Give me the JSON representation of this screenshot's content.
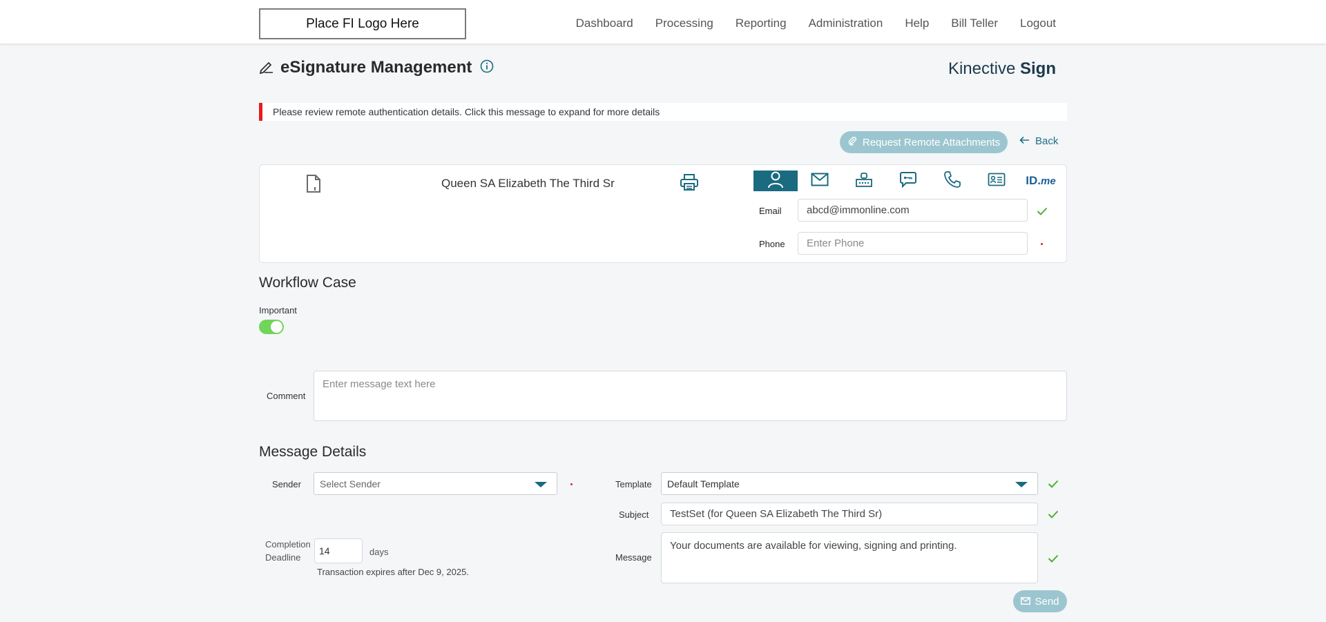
{
  "header": {
    "logo_text": "Place FI Logo Here",
    "nav": [
      "Dashboard",
      "Processing",
      "Reporting",
      "Administration",
      "Help",
      "Bill Teller",
      "Logout"
    ]
  },
  "page": {
    "title": "eSignature Management",
    "brand_light": "Kinective",
    "brand_bold": "Sign"
  },
  "alert": {
    "text": "Please review remote authentication details. Click this message to expand for more details",
    "color": "#e0201f"
  },
  "actions": {
    "request_attachments": "Request Remote Attachments",
    "back": "Back"
  },
  "signer": {
    "name": "Queen SA Elizabeth The Third Sr",
    "auth_tabs": [
      "person-icon",
      "mail-icon",
      "keypad-icon",
      "chat-icon",
      "phone-icon",
      "id-card-icon",
      "idme-icon"
    ],
    "idme_text": "ID.",
    "idme_suffix": "me",
    "email_label": "Email",
    "email_value": "abcd@immonline.com",
    "phone_label": "Phone",
    "phone_placeholder": "Enter Phone"
  },
  "workflow": {
    "heading": "Workflow Case",
    "important_label": "Important",
    "important_on": true,
    "comment_label": "Comment",
    "comment_placeholder": "Enter message text here"
  },
  "message_details": {
    "heading": "Message Details",
    "sender_label": "Sender",
    "sender_placeholder": "Select Sender",
    "template_label": "Template",
    "template_value": "Default Template",
    "subject_label": "Subject",
    "subject_value": "TestSet (for Queen SA Elizabeth The Third Sr)",
    "message_label": "Message",
    "message_value": "Your documents are available for viewing, signing and printing.",
    "deadline_label_1": "Completion",
    "deadline_label_2": "Deadline",
    "deadline_value": "14",
    "deadline_unit": "days",
    "expiry_note": "Transaction expires after Dec 9, 2025.",
    "send_label": "Send"
  },
  "colors": {
    "accent": "#1a6a80",
    "button_disabled": "#9cc6cf",
    "success": "#4caf30",
    "toggle_on": "#6fd65a"
  }
}
